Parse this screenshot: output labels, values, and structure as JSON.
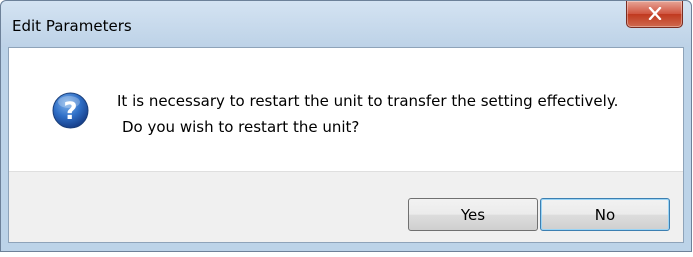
{
  "window": {
    "title": "Edit Parameters"
  },
  "dialog": {
    "icon": "question-icon",
    "message_line1": "It is necessary to restart the unit to transfer the setting effectively.",
    "message_line2": "Do you wish to restart the unit?"
  },
  "buttons": {
    "yes_label": "Yes",
    "no_label": "No",
    "default": "No"
  },
  "colors": {
    "titlebar": "#bdd2e7",
    "close_button": "#c0391f",
    "button_area": "#f0f0f0",
    "focus_border": "#3c7fb1"
  }
}
